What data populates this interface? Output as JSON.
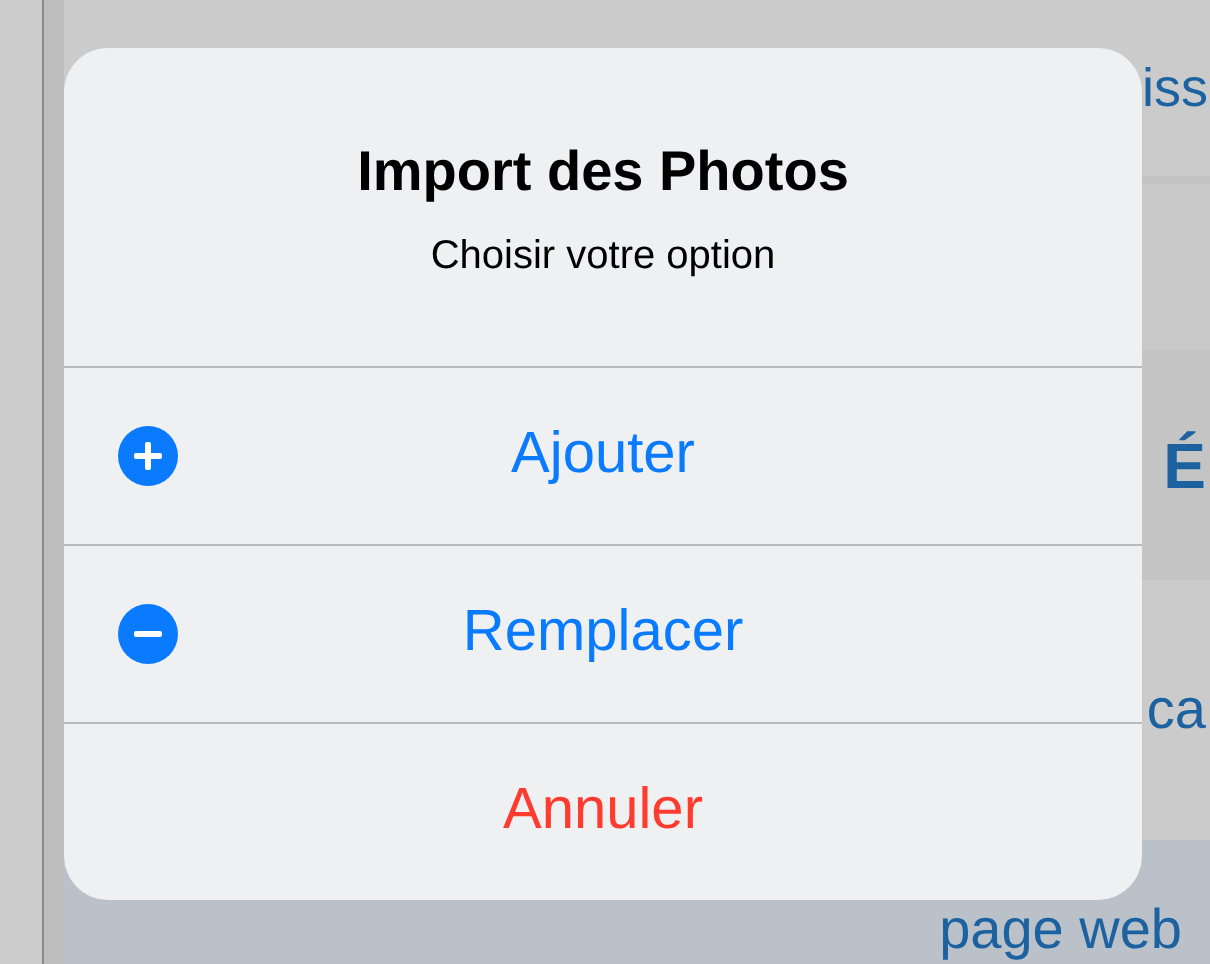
{
  "background": {
    "texts": [
      "iss",
      "É",
      "ca",
      "page web"
    ]
  },
  "sheet": {
    "title": "Import des Photos",
    "subtitle": "Choisir votre option",
    "actions": [
      {
        "label": "Ajouter",
        "kind": "add"
      },
      {
        "label": "Remplacer",
        "kind": "remove"
      },
      {
        "label": "Annuler",
        "kind": "cancel"
      }
    ]
  }
}
